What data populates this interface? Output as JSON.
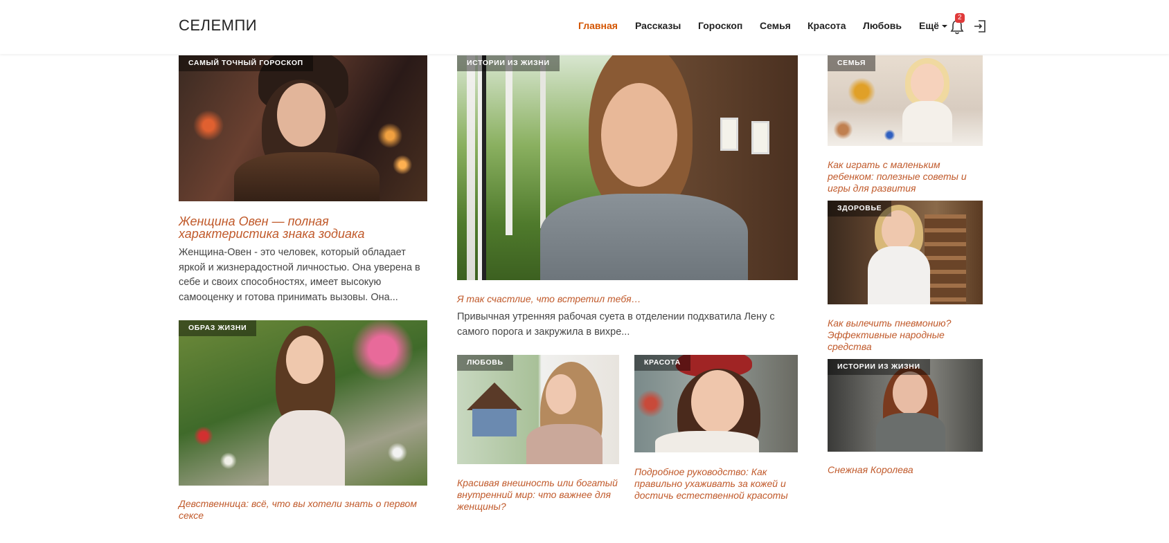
{
  "header": {
    "logo": "СЕЛЕМПИ",
    "nav": [
      {
        "label": "Главная",
        "active": true
      },
      {
        "label": "Рассказы",
        "active": false
      },
      {
        "label": "Гороскоп",
        "active": false
      },
      {
        "label": "Семья",
        "active": false
      },
      {
        "label": "Красота",
        "active": false
      },
      {
        "label": "Любовь",
        "active": false
      }
    ],
    "more_label": "Ещё",
    "notifications_count": "2",
    "icons": {
      "notifications": "bell-icon",
      "login": "login-icon",
      "more": "caret-down-icon"
    }
  },
  "colors": {
    "accent": "#d35400",
    "title": "#c0592a",
    "badge": "#e03a3a"
  },
  "articles": {
    "horoscope": {
      "tag": "Самый точный гороскоп",
      "title": "Женщина Овен — полная характеристика знака зодиака",
      "excerpt": "Женщина-Овен - это человек, который обладает яркой и жизнерадостной личностью. Она уверена в себе и своих способностях, имеет высокую самооценку и готова принимать вызовы. Она..."
    },
    "lifestyle": {
      "tag": "Образ жизни",
      "title": "Девственница: всё, что вы хотели знать о первом сексе"
    },
    "story_main": {
      "tag": "Истории из жизни",
      "title": "Я так счастлие, что встретил тебя…",
      "excerpt": "Привычная утренняя рабочая суета в отделении подхватила Лену с самого порога и закружила в вихре..."
    },
    "love": {
      "tag": "Любовь",
      "title": "Красивая внешность или богатый внутренний мир: что важнее для женщины?"
    },
    "beauty": {
      "tag": "Красота",
      "title": "Подробное руководство: Как правильно ухаживать за кожей и достичь естественной красоты"
    },
    "family": {
      "tag": "Семья",
      "title": "Как играть с маленьким ребенком: полезные советы и игры для развития"
    },
    "health": {
      "tag": "Здоровье",
      "title": "Как вылечить пневмонию? Эффективные народные средства"
    },
    "story_side": {
      "tag": "Истории из жизни",
      "title": "Снежная Королева"
    }
  }
}
